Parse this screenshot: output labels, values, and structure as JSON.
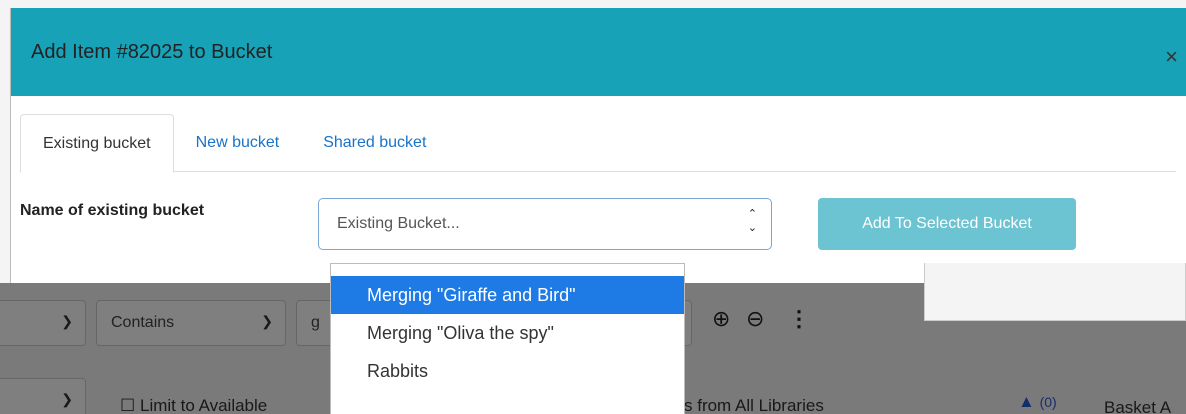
{
  "modal": {
    "title": "Add Item #82025 to Bucket",
    "close_label": "×",
    "tabs": [
      {
        "label": "Existing bucket",
        "active": true
      },
      {
        "label": "New bucket",
        "active": false
      },
      {
        "label": "Shared bucket",
        "active": false
      }
    ],
    "field_label": "Name of existing bucket",
    "combo_placeholder": "Existing Bucket...",
    "combo_value": "",
    "add_button_label": "Add To Selected Bucket",
    "header_color": "#17a2b8",
    "button_color": "#6cc3d1"
  },
  "dropdown": {
    "items": [
      {
        "label": "Merging \"Giraffe and Bird\"",
        "selected": true
      },
      {
        "label": "Merging \"Oliva the spy\"",
        "selected": false
      },
      {
        "label": "Rabbits",
        "selected": false
      }
    ],
    "selected_color": "#1e7be6"
  },
  "background": {
    "filter_operator": "Contains",
    "filter_value_fragment": "g",
    "limit_label": "Limit to Available",
    "libraries_label": "s from All Libraries",
    "basket_count": "(0)",
    "basket_label": "Basket A"
  }
}
